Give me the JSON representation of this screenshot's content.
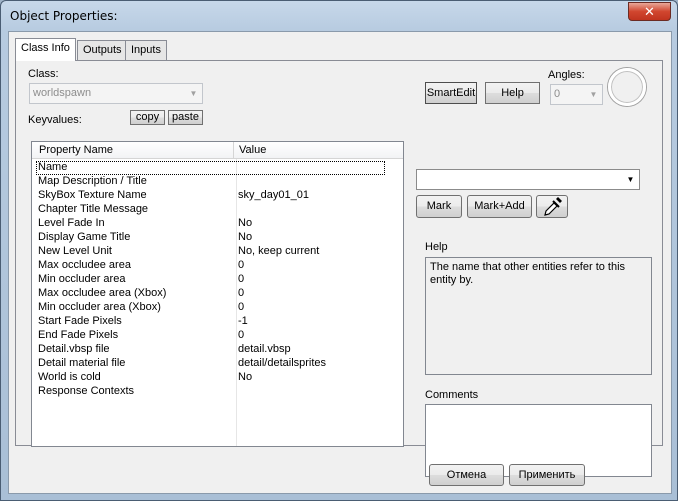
{
  "window": {
    "title": "Object Properties:"
  },
  "tabs": [
    {
      "label": "Class Info",
      "active": true
    },
    {
      "label": "Outputs",
      "active": false
    },
    {
      "label": "Inputs",
      "active": false
    }
  ],
  "class": {
    "label": "Class:",
    "value": "worldspawn"
  },
  "keyvalues": {
    "label": "Keyvalues:",
    "copy": "copy",
    "paste": "paste"
  },
  "toolbar": {
    "smartedit": "SmartEdit",
    "help": "Help"
  },
  "angles": {
    "label": "Angles:",
    "value": "0"
  },
  "table": {
    "headers": [
      "Property Name",
      "Value"
    ],
    "rows": [
      {
        "name": "Name",
        "value": ""
      },
      {
        "name": "Map Description / Title",
        "value": ""
      },
      {
        "name": "SkyBox Texture Name",
        "value": "sky_day01_01"
      },
      {
        "name": "Chapter Title Message",
        "value": ""
      },
      {
        "name": "Level Fade In",
        "value": "No"
      },
      {
        "name": "Display Game Title",
        "value": "No"
      },
      {
        "name": "New Level Unit",
        "value": "No, keep current"
      },
      {
        "name": "Max occludee area",
        "value": "0"
      },
      {
        "name": "Min occluder area",
        "value": "0"
      },
      {
        "name": "Max occludee area (Xbox)",
        "value": "0"
      },
      {
        "name": "Min occluder area (Xbox)",
        "value": "0"
      },
      {
        "name": "Start Fade Pixels",
        "value": "-1"
      },
      {
        "name": "End Fade Pixels",
        "value": "0"
      },
      {
        "name": "Detail.vbsp file",
        "value": "detail.vbsp"
      },
      {
        "name": "Detail material file",
        "value": "detail/detailsprites"
      },
      {
        "name": "World is cold",
        "value": "No"
      },
      {
        "name": "Response Contexts",
        "value": ""
      }
    ]
  },
  "mark": {
    "mark": "Mark",
    "mark_add": "Mark+Add",
    "value": ""
  },
  "help": {
    "label": "Help",
    "text": "The name that other entities refer to this entity by."
  },
  "comments": {
    "label": "Comments",
    "text": ""
  },
  "footer": {
    "cancel": "Отмена",
    "apply": "Применить"
  },
  "colors": {
    "window_frame": "#b7cbe0",
    "close_button": "#d1462f",
    "panel": "#f0f0f0"
  },
  "icons": {
    "close": "close-icon",
    "eyedropper": "eyedropper-icon",
    "dropdown": "chevron-down-icon"
  }
}
